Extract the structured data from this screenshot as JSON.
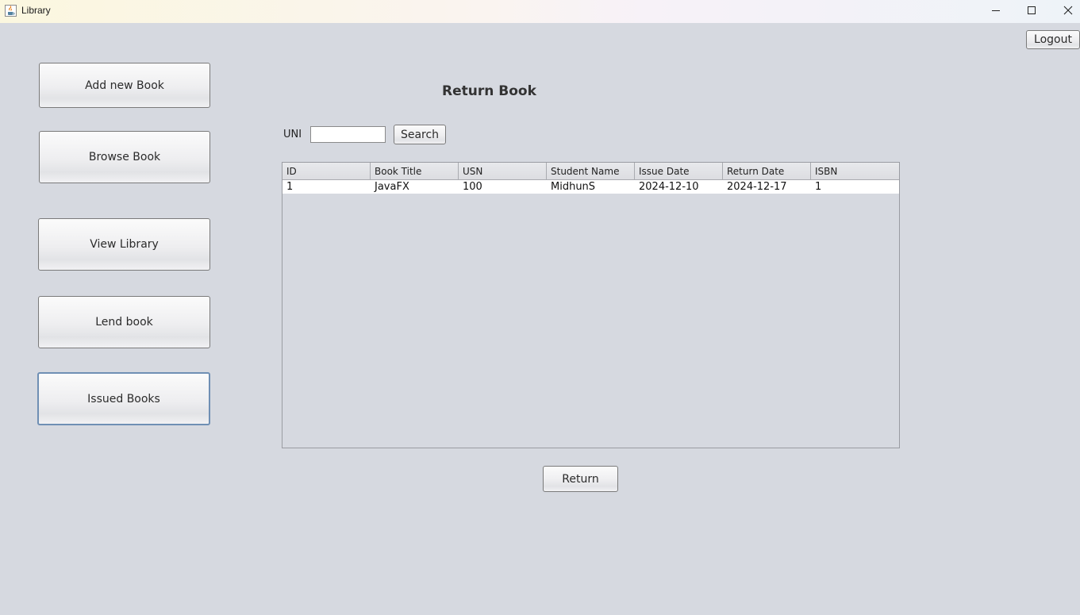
{
  "window": {
    "title": "Library"
  },
  "header": {
    "logout_label": "Logout"
  },
  "sidebar": {
    "items": [
      {
        "label": "Add new Book"
      },
      {
        "label": "Browse Book"
      },
      {
        "label": "View Library"
      },
      {
        "label": "Lend book"
      },
      {
        "label": "Issued Books"
      }
    ]
  },
  "main": {
    "title": "Return Book",
    "search": {
      "label": "UNI",
      "value": "",
      "button_label": "Search"
    },
    "table": {
      "columns": [
        "ID",
        "Book Title",
        "USN",
        "Student Name",
        "Issue Date",
        "Return Date",
        "ISBN"
      ],
      "rows": [
        [
          "1",
          "JavaFX",
          "100",
          "MidhunS",
          "2024-12-10",
          "2024-12-17",
          "1"
        ]
      ]
    },
    "return_label": "Return"
  },
  "icons": {
    "app": "java-cup-icon",
    "minimize": "minimize-icon",
    "maximize": "maximize-icon",
    "close": "close-icon"
  }
}
